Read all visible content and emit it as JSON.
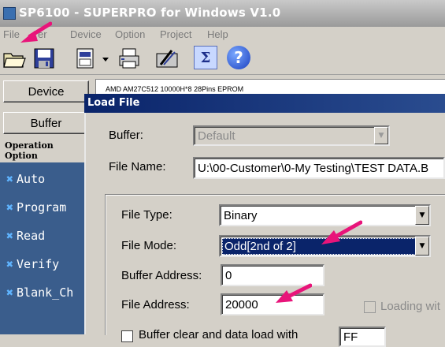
{
  "window": {
    "title": "SP6100 - SUPERPRO for Windows V1.0"
  },
  "menu": [
    "File",
    "Buffer",
    "Device",
    "Option",
    "Project",
    "Help"
  ],
  "menu_visible": [
    "File",
    "er",
    "Device",
    "Option",
    "Project",
    "Help"
  ],
  "toolbar": {
    "icons": [
      "open-folder-icon",
      "save-disk-icon",
      "device-select-icon",
      "dropdown-arrow-icon",
      "print-icon",
      "tools-icon",
      "sigma-icon",
      "help-icon"
    ],
    "sigma_glyph": "Σ",
    "help_glyph": "?"
  },
  "sidebar": {
    "device_button": "Device",
    "buffer_button": "Buffer",
    "operation_header": "Operation Option",
    "operations": [
      "Auto",
      "Program",
      "Read",
      "Verify",
      "Blank_Ch"
    ]
  },
  "device_field": {
    "value": "AMD  AM27C512  10000H*8  28Pins  EPROM"
  },
  "dialog": {
    "title": "Load File",
    "buffer_label": "Buffer:",
    "buffer_value": "Default",
    "filename_label": "File Name:",
    "filename_value": "U:\\00-Customer\\0-My Testing\\TEST DATA.B",
    "filetype_label": "File Type:",
    "filetype_value": "Binary",
    "filemode_label": "File Mode:",
    "filemode_value": "Odd[2nd of 2]",
    "bufaddr_label": "Buffer Address:",
    "bufaddr_value": "0",
    "fileaddr_label": "File Address:",
    "fileaddr_value": "20000",
    "loading_label": "Loading wit",
    "bufclear_label": "Buffer clear and data load with",
    "bufclear_value": "FF"
  },
  "colors": {
    "annotation_arrow": "#e8147a",
    "selection": "#0a246a",
    "op_panel": "#3a5d8c"
  }
}
